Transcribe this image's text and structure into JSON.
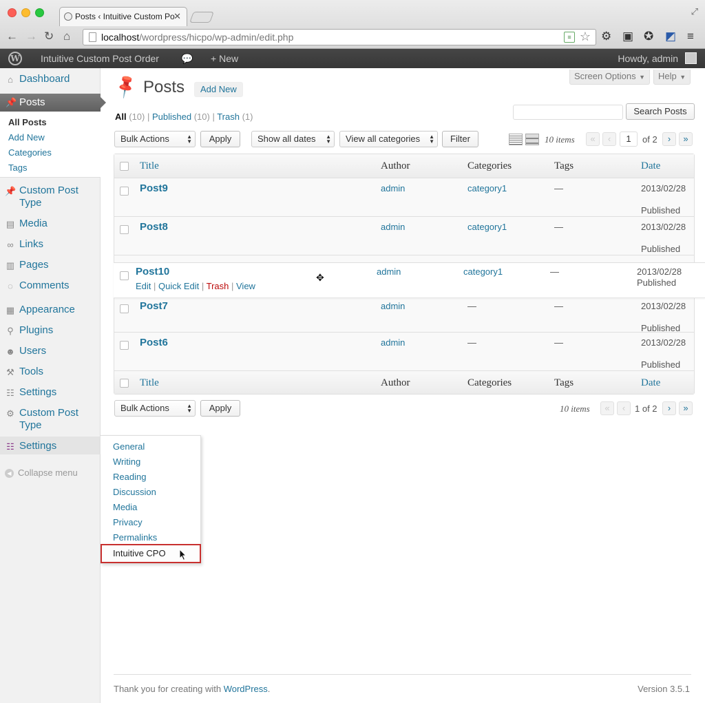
{
  "browser": {
    "tab_title": "Posts ‹ Intuitive Custom Po",
    "url_host": "localhost",
    "url_path": "/wordpress/hicpo/wp-admin/edit.php"
  },
  "adminbar": {
    "site_name": "Intuitive Custom Post Order",
    "new_label": "New",
    "greeting": "Howdy, admin"
  },
  "sidebar": {
    "dashboard": "Dashboard",
    "posts": "Posts",
    "posts_sub": [
      "All Posts",
      "Add New",
      "Categories",
      "Tags"
    ],
    "custom_post_type_1": "Custom Post Type",
    "media": "Media",
    "links": "Links",
    "pages": "Pages",
    "comments": "Comments",
    "appearance": "Appearance",
    "plugins": "Plugins",
    "users": "Users",
    "tools": "Tools",
    "settings_1": "Settings",
    "custom_post_type_2": "Custom Post Type",
    "settings_2": "Settings",
    "collapse": "Collapse menu"
  },
  "flyout": {
    "items": [
      "General",
      "Writing",
      "Reading",
      "Discussion",
      "Media",
      "Privacy",
      "Permalinks"
    ],
    "highlighted": "Intuitive CPO"
  },
  "header": {
    "screen_options": "Screen Options",
    "help": "Help",
    "title": "Posts",
    "add_new": "Add New"
  },
  "views": {
    "all": "All",
    "all_count": "(10)",
    "published": "Published",
    "published_count": "(10)",
    "trash": "Trash",
    "trash_count": "(1)"
  },
  "search": {
    "button": "Search Posts"
  },
  "tablenav": {
    "bulk_actions": "Bulk Actions",
    "apply": "Apply",
    "dates": "Show all dates",
    "categories": "View all categories",
    "filter": "Filter",
    "items": "10 items",
    "page_current": "1",
    "page_of": "of 2",
    "bottom_pages": "1 of 2",
    "first": "«",
    "prev": "‹",
    "next": "›",
    "last": "»"
  },
  "table": {
    "columns": {
      "title": "Title",
      "author": "Author",
      "categories": "Categories",
      "tags": "Tags",
      "date": "Date"
    },
    "rows": [
      {
        "title": "Post9",
        "author": "admin",
        "categories": "category1",
        "tags": "—",
        "date": "2013/02/28",
        "status": "Published"
      },
      {
        "title": "Post8",
        "author": "admin",
        "categories": "category1",
        "tags": "—",
        "date": "2013/02/28",
        "status": "Published"
      },
      {
        "title": "Post7",
        "author": "admin",
        "categories": "—",
        "tags": "—",
        "date": "2013/02/28",
        "status": "Published"
      },
      {
        "title": "Post6",
        "author": "admin",
        "categories": "—",
        "tags": "—",
        "date": "2013/02/28",
        "status": "Published"
      }
    ],
    "dragging_row": {
      "title": "Post10",
      "author": "admin",
      "categories": "category1",
      "tags": "—",
      "date": "2013/02/28",
      "status": "Published",
      "actions": {
        "edit": "Edit",
        "quick_edit": "Quick Edit",
        "trash": "Trash",
        "view": "View"
      }
    }
  },
  "footer": {
    "thanks": "Thank you for creating with",
    "wordpress": "WordPress",
    "version": "Version 3.5.1"
  }
}
